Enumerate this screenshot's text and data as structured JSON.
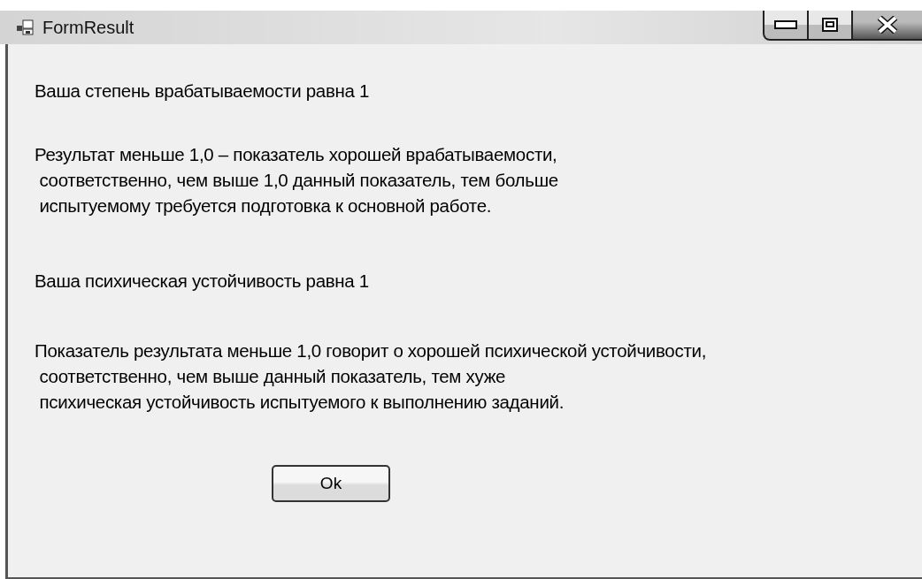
{
  "window": {
    "title": "FormResult"
  },
  "paragraphs": [
    "Ваша степень врабатываемости равна 1",
    "Результат меньше 1,0 – показатель хорошей врабатываемости,\n соответственно, чем выше 1,0 данный показатель, тем больше\n испытуемому требуется подготовка к основной работе.",
    "Ваша психическая устойчивость равна 1",
    "Показатель результата меньше 1,0 говорит о хорошей психической устойчивости,\n соответственно, чем выше данный показатель, тем хуже\n психическая устойчивость испытуемого к выполнению заданий."
  ],
  "buttons": [
    "Ok"
  ]
}
